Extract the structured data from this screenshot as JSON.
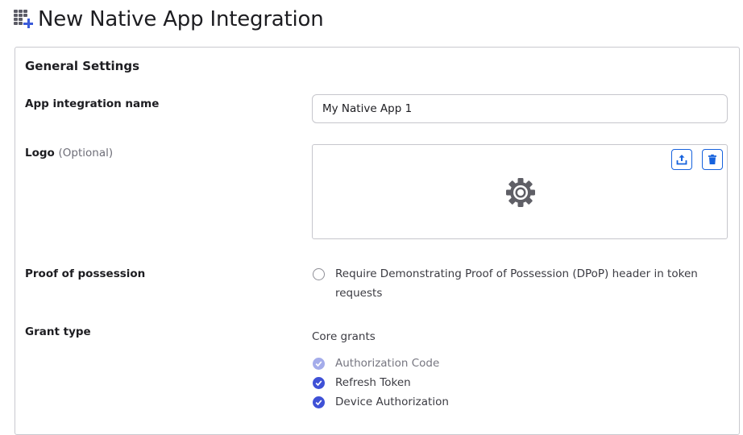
{
  "header": {
    "icon": "apps-add-icon",
    "title": "New Native App Integration"
  },
  "general_settings": {
    "title": "General Settings",
    "app_name": {
      "label": "App integration name",
      "value": "My Native App 1"
    },
    "logo": {
      "label": "Logo",
      "optional": "(Optional)",
      "upload_icon": "upload-icon",
      "delete_icon": "trash-icon",
      "placeholder_icon": "gear-icon"
    },
    "proof_of_possession": {
      "label": "Proof of possession",
      "checkbox_text_line1": "Require Demonstrating Proof of Possession (DPoP) header in token",
      "checkbox_text_line2": "requests",
      "checked": false
    },
    "grant_type": {
      "label": "Grant type",
      "core_grants_label": "Core grants",
      "grants": [
        {
          "label": "Authorization Code",
          "checked": true,
          "disabled": true
        },
        {
          "label": "Refresh Token",
          "checked": true,
          "disabled": false
        },
        {
          "label": "Device Authorization",
          "checked": true,
          "disabled": false
        }
      ]
    }
  },
  "colors": {
    "accent": "#3f51d6",
    "link_blue": "#1662dd",
    "disabled_check": "#a4acea"
  }
}
